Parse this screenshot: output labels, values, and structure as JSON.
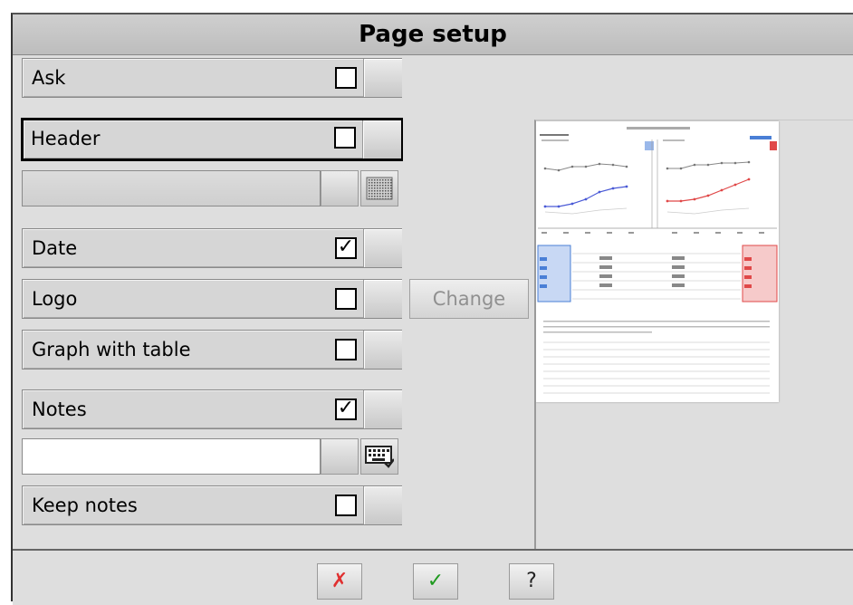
{
  "dialog": {
    "title": "Page setup"
  },
  "options": {
    "ask": {
      "label": "Ask",
      "checked": false,
      "mark": ""
    },
    "header": {
      "label": "Header",
      "checked": false,
      "mark": ""
    },
    "header_text": {
      "value": ""
    },
    "date": {
      "label": "Date",
      "checked": true,
      "mark": "✓"
    },
    "logo": {
      "label": "Logo",
      "checked": false,
      "mark": ""
    },
    "graph_with_table": {
      "label": "Graph with table",
      "checked": false,
      "mark": ""
    },
    "notes": {
      "label": "Notes",
      "checked": true,
      "mark": "✓"
    },
    "notes_text": {
      "value": ""
    },
    "keep_notes": {
      "label": "Keep notes",
      "checked": false,
      "mark": ""
    }
  },
  "logo_change": {
    "label": "Change",
    "enabled": false
  },
  "footer": {
    "cancel_label": "✗",
    "ok_label": "✓",
    "help_label": "?"
  },
  "colors": {
    "cancel": "#e03030",
    "ok": "#1f9a1f",
    "left_panel": "#4a7fd6",
    "right_panel": "#e04848"
  }
}
